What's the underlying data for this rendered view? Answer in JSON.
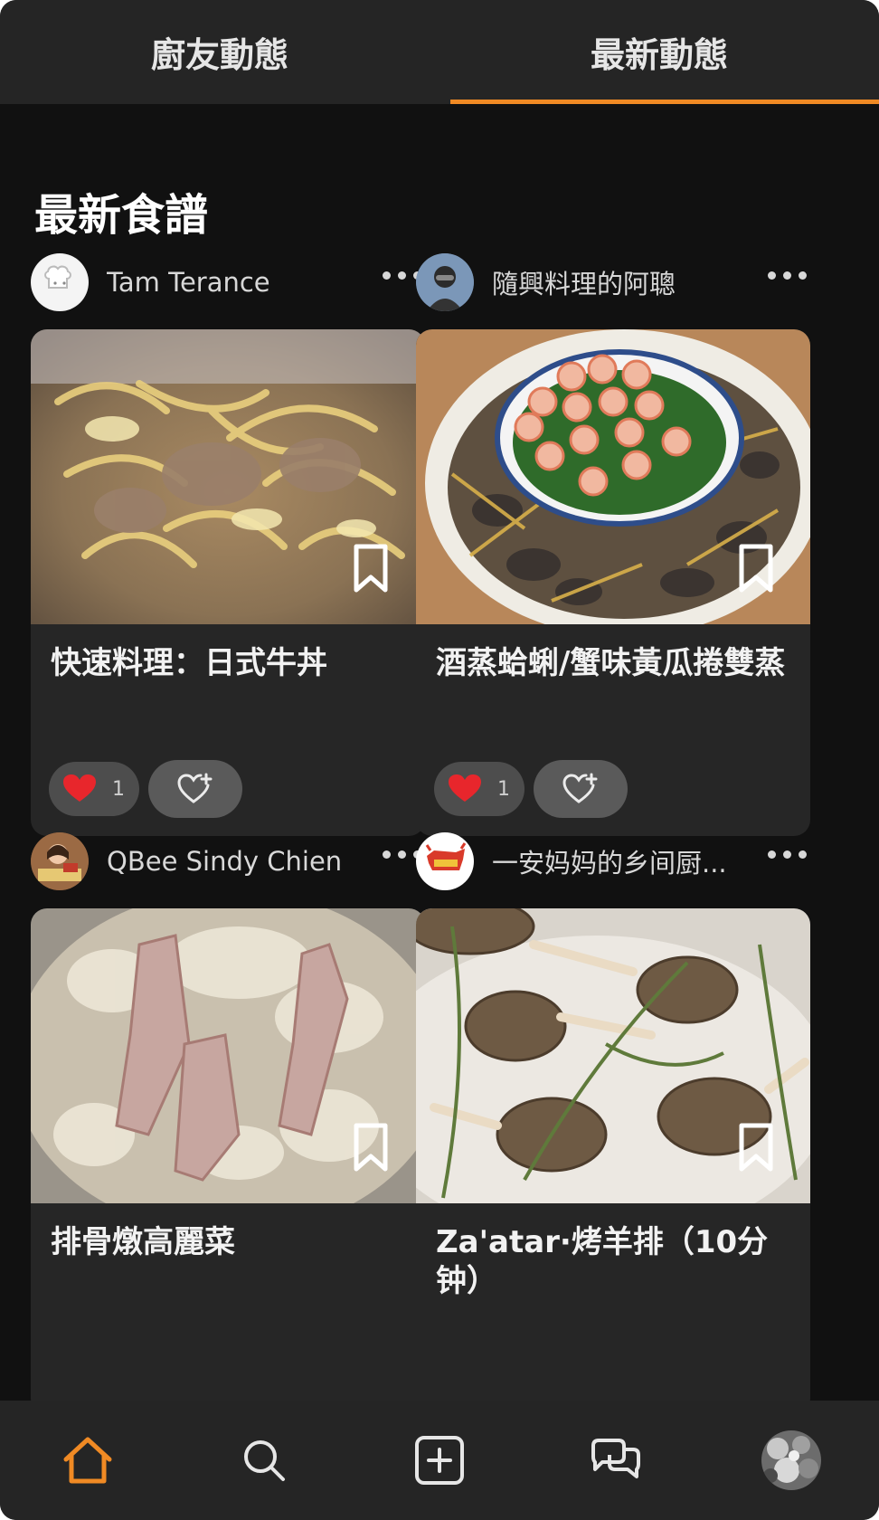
{
  "tabs": [
    {
      "label": "廚友動態",
      "active": false
    },
    {
      "label": "最新動態",
      "active": true
    }
  ],
  "section_title": "最新食譜",
  "recipes": [
    {
      "author": "Tam Terance",
      "title": "快速料理：日式牛丼",
      "likes": "1"
    },
    {
      "author": "隨興料理的阿聰",
      "title": "酒蒸蛤蜊/蟹味黃瓜捲雙蒸",
      "likes": "1"
    },
    {
      "author": "QBee Sindy Chien",
      "title": "排骨燉高麗菜"
    },
    {
      "author": "一安妈妈的乡间厨...",
      "title": "Za'atar·烤羊排（10分钟）"
    }
  ],
  "icons": {
    "more": "more-dots-icon",
    "bookmark": "bookmark-icon",
    "heart": "heart-icon",
    "add_like": "heart-plus-icon",
    "nav": [
      "home-icon",
      "search-icon",
      "add-icon",
      "chat-icon",
      "profile-avatar"
    ]
  },
  "colors": {
    "accent": "#f08a24",
    "background": "#111111",
    "card": "#262626",
    "heart": "#e8262c"
  }
}
